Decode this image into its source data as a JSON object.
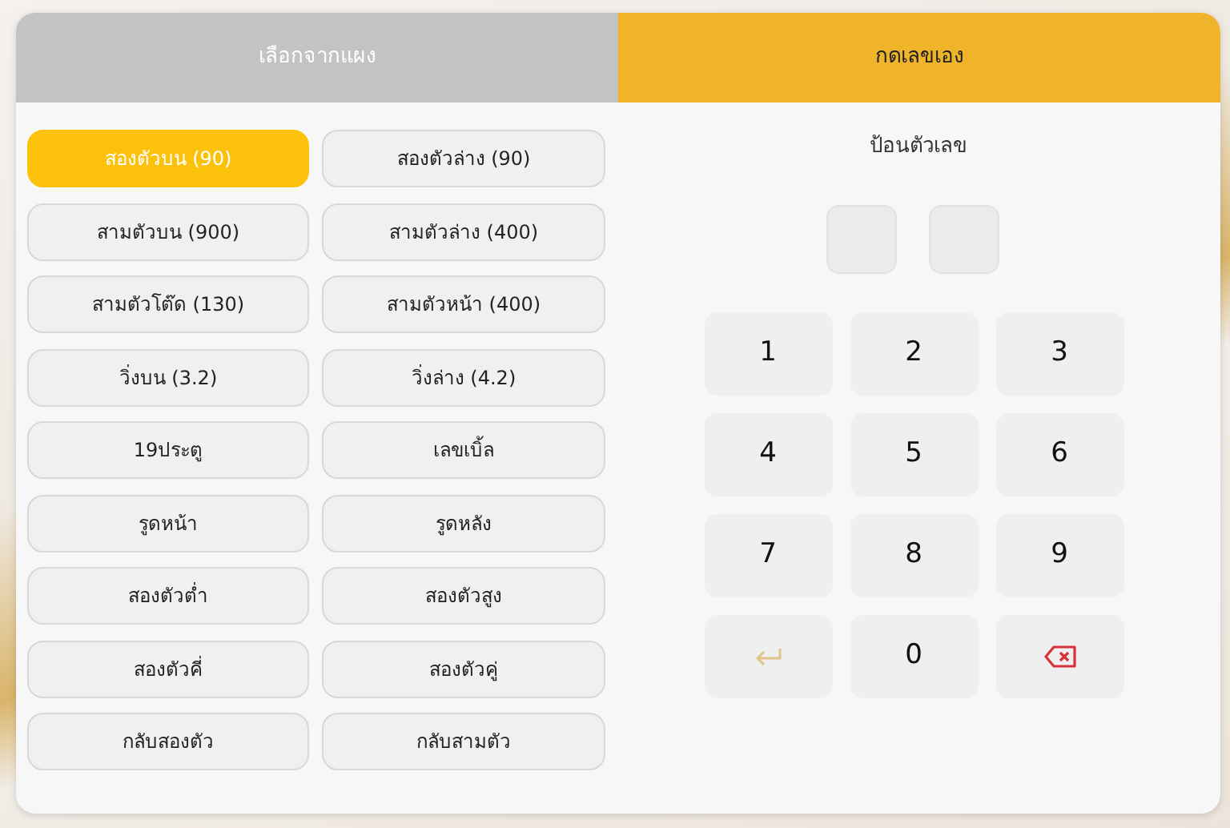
{
  "tabs": [
    {
      "label": "เลือกจากแผง",
      "selected": false
    },
    {
      "label": "กดเลขเอง",
      "selected": true
    }
  ],
  "bet_types": [
    {
      "label": "สองตัวบน (90)",
      "selected": true
    },
    {
      "label": "สองตัวล่าง (90)",
      "selected": false
    },
    {
      "label": "สามตัวบน (900)",
      "selected": false
    },
    {
      "label": "สามตัวล่าง (400)",
      "selected": false
    },
    {
      "label": "สามตัวโต๊ด (130)",
      "selected": false
    },
    {
      "label": "สามตัวหน้า (400)",
      "selected": false
    },
    {
      "label": "วิ่งบน (3.2)",
      "selected": false
    },
    {
      "label": "วิ่งล่าง (4.2)",
      "selected": false
    },
    {
      "label": "19ประตู",
      "selected": false
    },
    {
      "label": "เลขเบิ้ล",
      "selected": false
    },
    {
      "label": "รูดหน้า",
      "selected": false
    },
    {
      "label": "รูดหลัง",
      "selected": false
    },
    {
      "label": "สองตัวต่ำ",
      "selected": false
    },
    {
      "label": "สองตัวสูง",
      "selected": false
    },
    {
      "label": "สองตัวคี่",
      "selected": false
    },
    {
      "label": "สองตัวคู่",
      "selected": false
    },
    {
      "label": "กลับสองตัว",
      "selected": false
    },
    {
      "label": "กลับสามตัว",
      "selected": false
    }
  ],
  "entry": {
    "title": "ป้อนตัวเลข",
    "digit_slots": [
      {
        "filled": false
      },
      {
        "filled": false
      }
    ],
    "keypad": [
      {
        "kind": "digit",
        "label": "1"
      },
      {
        "kind": "digit",
        "label": "2"
      },
      {
        "kind": "digit",
        "label": "3"
      },
      {
        "kind": "digit",
        "label": "4"
      },
      {
        "kind": "digit",
        "label": "5"
      },
      {
        "kind": "digit",
        "label": "6"
      },
      {
        "kind": "digit",
        "label": "7"
      },
      {
        "kind": "digit",
        "label": "8"
      },
      {
        "kind": "digit",
        "label": "9"
      },
      {
        "kind": "enter"
      },
      {
        "kind": "digit",
        "label": "0"
      },
      {
        "kind": "backspace"
      }
    ]
  }
}
